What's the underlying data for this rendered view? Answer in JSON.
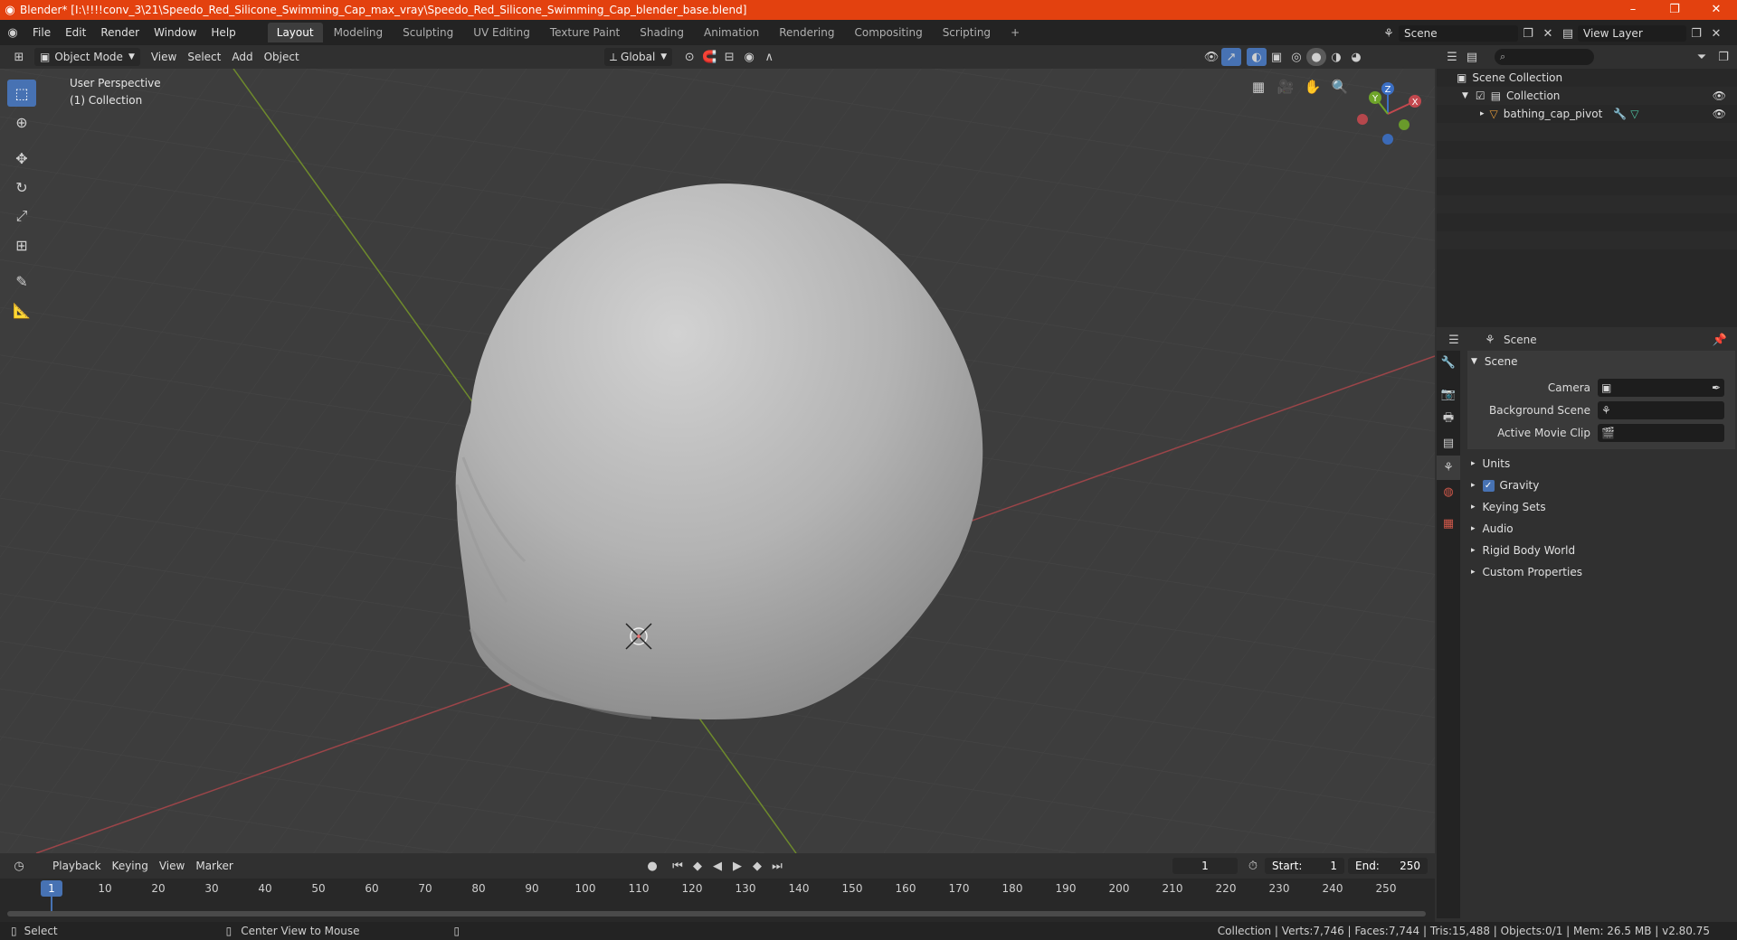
{
  "window": {
    "title": "Blender* [I:\\!!!!conv_3\\21\\Speedo_Red_Silicone_Swimming_Cap_max_vray\\Speedo_Red_Silicone_Swimming_Cap_blender_base.blend]",
    "minimize": "–",
    "maximize": "❐",
    "close": "✕"
  },
  "menu": {
    "items": [
      "File",
      "Edit",
      "Render",
      "Window",
      "Help"
    ],
    "workspaces": [
      "Layout",
      "Modeling",
      "Sculpting",
      "UV Editing",
      "Texture Paint",
      "Shading",
      "Animation",
      "Rendering",
      "Compositing",
      "Scripting"
    ],
    "active_workspace": "Layout",
    "add_workspace": "+",
    "scene_name": "Scene",
    "view_layer": "View Layer"
  },
  "viewport_header": {
    "mode": "Object Mode",
    "menus": [
      "View",
      "Select",
      "Add",
      "Object"
    ],
    "transform_orientation": "Global"
  },
  "viewport": {
    "perspective_label": "User Perspective",
    "collection_label": "(1) Collection",
    "gizmo": {
      "x": "X",
      "y": "Y",
      "z": "Z"
    },
    "colors": {
      "x_axis": "#a8454a",
      "y_axis": "#7a9b2a",
      "background": "#3d3d3d",
      "object": "#b8b8b8"
    }
  },
  "outliner": {
    "root": "Scene Collection",
    "collection": "Collection",
    "object": "bathing_cap_pivot"
  },
  "properties": {
    "context": "Scene",
    "panel_title": "Scene",
    "fields": {
      "camera": "Camera",
      "background_scene": "Background Scene",
      "active_movie_clip": "Active Movie Clip"
    },
    "sections": [
      "Units",
      "Gravity",
      "Keying Sets",
      "Audio",
      "Rigid Body World",
      "Custom Properties"
    ],
    "gravity_checked": true
  },
  "timeline": {
    "menus": [
      "Playback",
      "Keying",
      "View",
      "Marker"
    ],
    "current_frame": "1",
    "start_label": "Start:",
    "start_value": "1",
    "end_label": "End:",
    "end_value": "250",
    "ticks": [
      "10",
      "20",
      "30",
      "40",
      "50",
      "60",
      "70",
      "80",
      "90",
      "100",
      "110",
      "120",
      "130",
      "140",
      "150",
      "160",
      "170",
      "180",
      "190",
      "200",
      "210",
      "220",
      "230",
      "240",
      "250"
    ],
    "playhead": "1"
  },
  "statusbar": {
    "select": "Select",
    "center_view": "Center View to Mouse",
    "stats": "Collection | Verts:7,746 | Faces:7,744 | Tris:15,488 | Objects:0/1 | Mem: 26.5 MB | v2.80.75"
  }
}
